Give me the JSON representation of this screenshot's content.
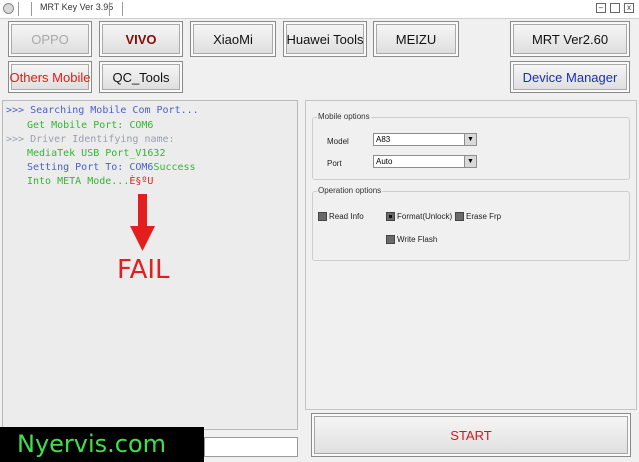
{
  "window": {
    "title": "MRT Key Ver 3.95",
    "minimize_glyph": "–",
    "close_glyph": "x"
  },
  "buttons": {
    "oppo": "OPPO",
    "vivo": "VIVO",
    "xiaomi": "XiaoMi",
    "huawei": "Huawei Tools",
    "meizu": "MEIZU",
    "mrt": "MRT Ver2.60",
    "others": "Others Mobile",
    "qc": "QC_Tools",
    "device_manager": "Device Manager"
  },
  "log": {
    "line1": ">>> Searching Mobile Com Port...",
    "line2": "Get Mobile Port: COM6",
    "line3": ">>> Driver Identifying name:",
    "line4": "MediaTek USB Port_V1632",
    "line5a": "Setting Port To: COM6",
    "line5b": "Success",
    "line6a": "Into META Mode...",
    "line6b": "È§ºU"
  },
  "annotation": {
    "fail_text": "FAIL"
  },
  "watermark": {
    "text": "Nyervis.com"
  },
  "mobile_options": {
    "legend": "Mobile options",
    "model_label": "Model",
    "model_value": "A83",
    "port_label": "Port",
    "port_value": "Auto"
  },
  "operation_options": {
    "legend": "Operation options",
    "read_info": "Read Info",
    "format_unlock": "Format(Unlock)",
    "erase_frp": "Erase Frp",
    "write_flash": "Write Flash"
  },
  "start": {
    "label": "START"
  },
  "colors": {
    "prompt_blue": "#4a5fcf",
    "prompt_gray": "#9aa0b0",
    "log_green": "#2fb82f",
    "error_red": "#e31e1e",
    "vivo_text": "#8b0a0a",
    "others_text": "#e01a1a",
    "device_manager_text": "#1b2fb8"
  }
}
